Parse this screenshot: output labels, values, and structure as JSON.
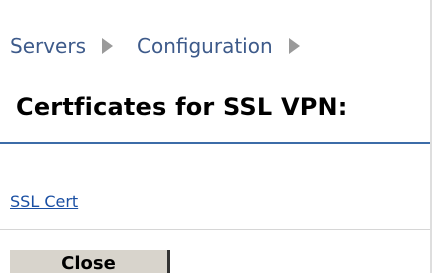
{
  "breadcrumb": {
    "items": [
      {
        "label": "Servers"
      },
      {
        "label": "Configuration"
      }
    ]
  },
  "page": {
    "title": "Certficates for SSL VPN:"
  },
  "certificates": {
    "items": [
      {
        "label": "SSL Cert"
      }
    ]
  },
  "actions": {
    "close_label": "Close"
  },
  "colors": {
    "breadcrumb_text": "#3d5a8a",
    "title_rule": "#3c6ca8",
    "link": "#1a4fa3",
    "button_bg": "#d8d4cc"
  }
}
